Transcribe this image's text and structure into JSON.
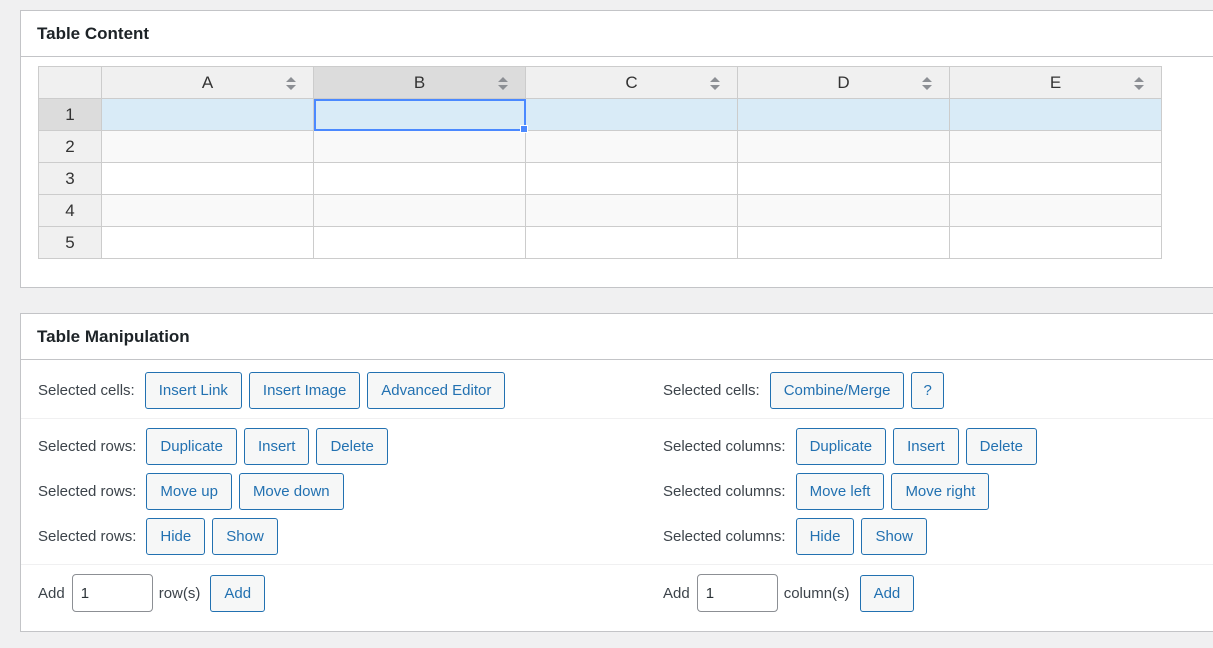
{
  "content_box": {
    "title": "Table Content",
    "columns": [
      "A",
      "B",
      "C",
      "D",
      "E"
    ],
    "rows": [
      "1",
      "2",
      "3",
      "4",
      "5"
    ],
    "selected_column": "B",
    "selected_row": "1"
  },
  "manip_box": {
    "title": "Table Manipulation",
    "left": {
      "cells_label": "Selected cells:",
      "insert_link": "Insert Link",
      "insert_image": "Insert Image",
      "advanced_editor": "Advanced Editor",
      "rows_label": "Selected rows:",
      "duplicate": "Duplicate",
      "insert": "Insert",
      "delete": "Delete",
      "move_up": "Move up",
      "move_down": "Move down",
      "hide": "Hide",
      "show": "Show",
      "add_label": "Add",
      "add_value": "1",
      "unit": "row(s)",
      "add_button": "Add"
    },
    "right": {
      "cells_label": "Selected cells:",
      "combine": "Combine/Merge",
      "help": "?",
      "cols_label": "Selected columns:",
      "duplicate": "Duplicate",
      "insert": "Insert",
      "delete": "Delete",
      "move_left": "Move left",
      "move_right": "Move right",
      "hide": "Hide",
      "show": "Show",
      "add_label": "Add",
      "add_value": "1",
      "unit": "column(s)",
      "add_button": "Add"
    }
  }
}
